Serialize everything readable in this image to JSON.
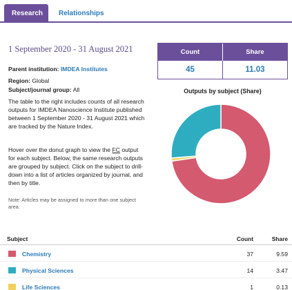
{
  "tabs": {
    "research": "Research",
    "relationships": "Relationships"
  },
  "date_range": "1 September 2020 - 31 August 2021",
  "stats": {
    "count_label": "Count",
    "share_label": "Share",
    "count": "45",
    "share": "11.03"
  },
  "institution": {
    "label": "Parent institution:",
    "value": "IMDEA Institutes"
  },
  "region": {
    "label": "Region:",
    "value": "Global"
  },
  "group": {
    "label": "Subject/journal group:",
    "value": "All"
  },
  "description": "The table to the right includes counts of all research outputs for IMDEA Nanoscience Institute published between 1 September 2020 - 31 August 2021 which are tracked by the Nature Index.",
  "hover_text": {
    "before": "Hover over the donut graph to view the",
    "fc": "FC",
    "after": "output for each subject. Below, the same research outputs are grouped by subject. Click on the subject to drill-down into a list of articles organized by journal, and then by title."
  },
  "note": "Note: Articles may be assigned to more than one subject area.",
  "chart_title": "Outputs by subject (Share)",
  "colors": {
    "chemistry": "#d45a6f",
    "physical": "#2eadc1",
    "life": "#f2d05e",
    "accent": "#6b4f9a",
    "link": "#2a7ab8"
  },
  "chart_data": {
    "type": "pie",
    "title": "Outputs by subject (Share)",
    "categories": [
      "Chemistry",
      "Physical Sciences",
      "Life Sciences"
    ],
    "values": [
      9.59,
      3.47,
      0.13
    ]
  },
  "table": {
    "headers": {
      "subject": "Subject",
      "count": "Count",
      "share": "Share"
    },
    "rows": [
      {
        "subject": "Chemistry",
        "count": "37",
        "share": "9.59"
      },
      {
        "subject": "Physical Sciences",
        "count": "14",
        "share": "3.47"
      },
      {
        "subject": "Life Sciences",
        "count": "1",
        "share": "0.13"
      }
    ]
  }
}
